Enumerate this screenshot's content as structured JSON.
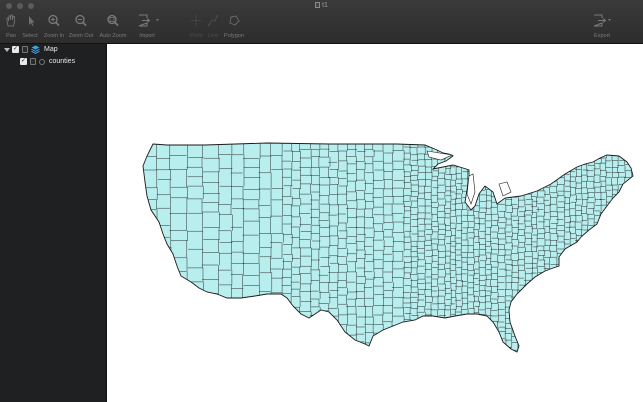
{
  "window": {
    "title": "t1"
  },
  "toolbar": {
    "pan": "Pan",
    "select": "Select",
    "zoom_in": "Zoom In",
    "zoom_out": "Zoom Out",
    "auto_zoom": "Auto Zoom",
    "import": "Import",
    "point": "Point",
    "line": "Line",
    "polygon": "Polygon",
    "export": "Export"
  },
  "layers": {
    "group": {
      "name": "Map",
      "checked": true,
      "expanded": true
    },
    "items": [
      {
        "name": "counties",
        "checked": true
      }
    ]
  },
  "map": {
    "fill_color": "#b9eeef",
    "stroke_color": "#1a1a1a",
    "background": "#ffffff"
  }
}
